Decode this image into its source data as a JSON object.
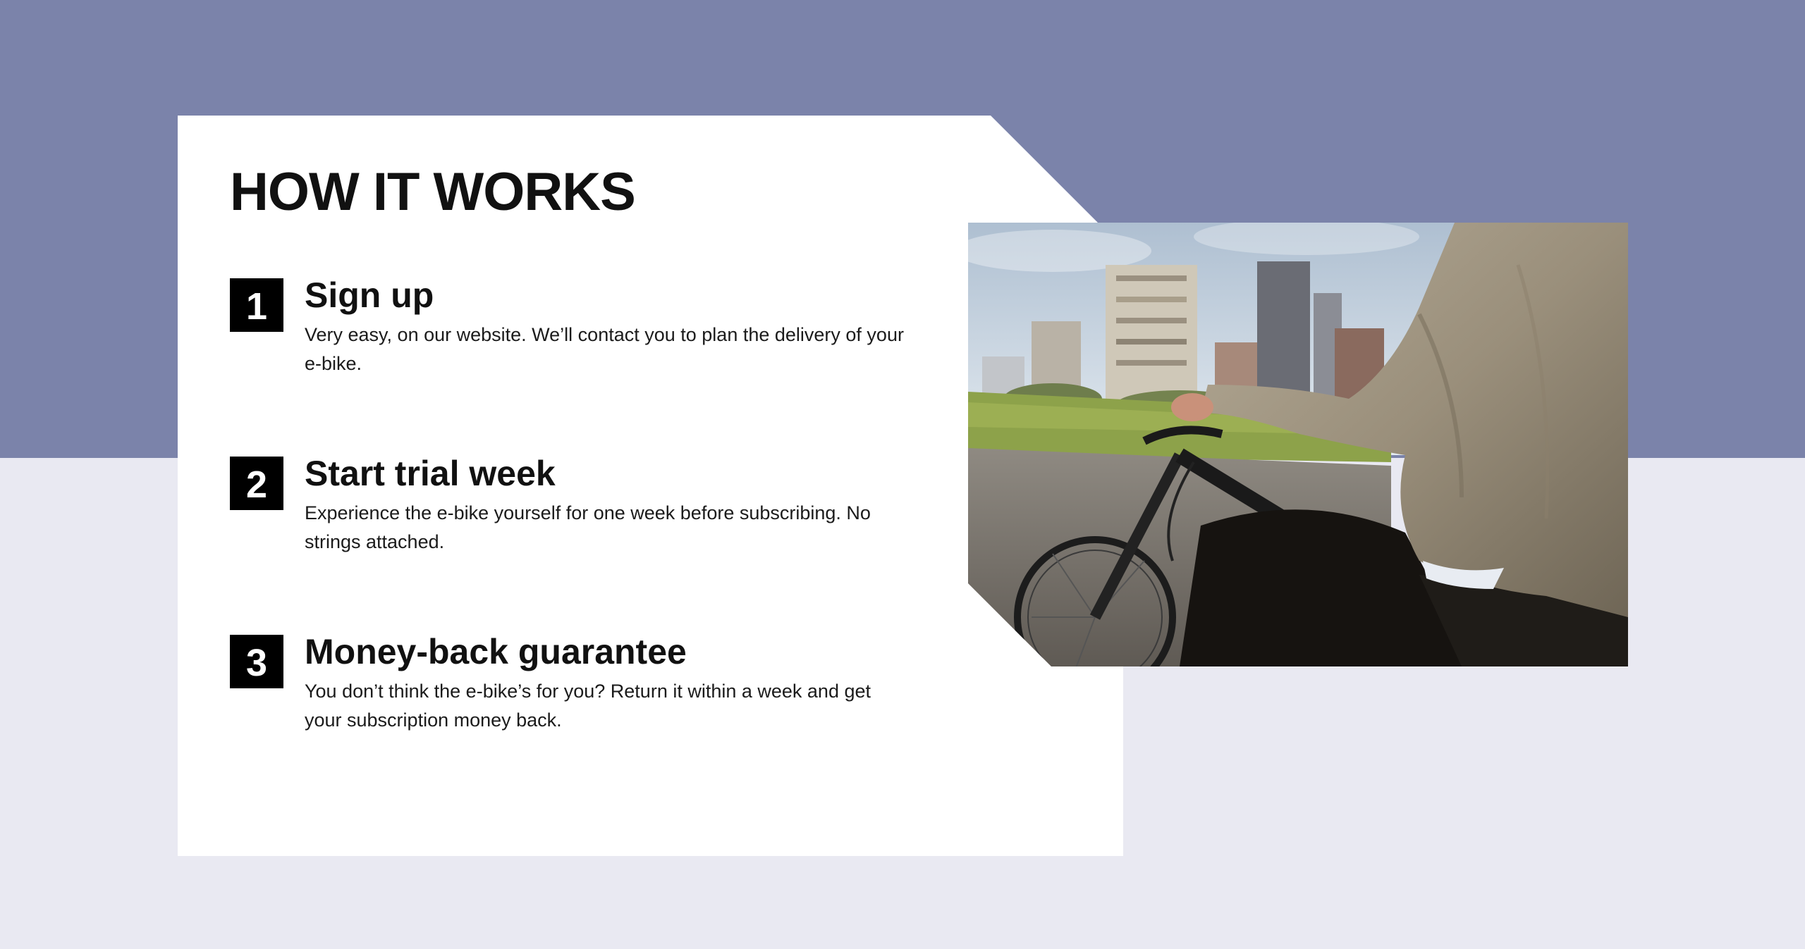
{
  "section": {
    "title": "HOW IT WORKS"
  },
  "steps": [
    {
      "number": "1",
      "title": "Sign up",
      "description": "Very easy, on our website. We’ll contact you to plan the delivery of your e-bike."
    },
    {
      "number": "2",
      "title": "Start trial week",
      "description": "Experience the e-bike yourself for one week before subscribing. No strings attached."
    },
    {
      "number": "3",
      "title": "Money-back guarantee",
      "description": "You don’t think the e-bike’s for you? Return it within a week and get your subscription money back."
    }
  ],
  "colors": {
    "top_band": "#7b83aa",
    "page_background": "#e9e9f2",
    "card": "#ffffff",
    "number_badge": "#000000"
  },
  "image": {
    "subject": "person riding an e-bike in a city park"
  }
}
